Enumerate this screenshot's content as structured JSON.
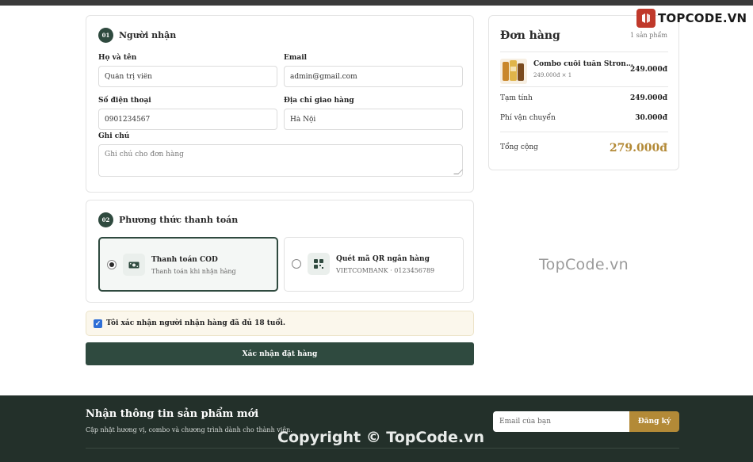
{
  "recipient": {
    "step": "01",
    "title": "Người nhận",
    "name_label": "Họ và tên",
    "name_value": "Quản trị viên",
    "email_label": "Email",
    "email_value": "admin@gmail.com",
    "phone_label": "Số điện thoại",
    "phone_value": "0901234567",
    "address_label": "Địa chỉ giao hàng",
    "address_value": "Hà Nội",
    "note_label": "Ghi chú",
    "note_placeholder": "Ghi chú cho đơn hàng"
  },
  "payment": {
    "step": "02",
    "title": "Phương thức thanh toán",
    "options": [
      {
        "name": "Thanh toán COD",
        "desc": "Thanh toán khi nhận hàng",
        "selected": true,
        "icon": "cash-icon"
      },
      {
        "name": "Quét mã QR ngân hàng",
        "desc": "VIETCOMBANK · 0123456789",
        "selected": false,
        "icon": "qr-code-icon"
      }
    ]
  },
  "agreement": {
    "text": "Tôi xác nhận người nhận hàng đã đủ 18 tuổi.",
    "checked": true
  },
  "submit_label": "Xác nhận đặt hàng",
  "order": {
    "title": "Đơn hàng",
    "count": "1 sản phẩm",
    "item": {
      "name": "Combo cuối tuần Strongbow…",
      "sub": "249.000đ × 1",
      "price": "249.000đ"
    },
    "subtotal_label": "Tạm tính",
    "subtotal_value": "249.000đ",
    "shipping_label": "Phí vận chuyển",
    "shipping_value": "30.000đ",
    "total_label": "Tổng cộng",
    "total_value": "279.000đ"
  },
  "footer": {
    "title": "Nhận thông tin sản phẩm mới",
    "subtitle": "Cập nhật hương vị, combo và chương trình dành cho thành viên.",
    "email_placeholder": "Email của bạn",
    "subscribe_label": "Đăng ký"
  },
  "watermarks": {
    "logo_text": "TOPCODE.VN",
    "center_text": "TopCode.vn",
    "copyright": "Copyright © TopCode.vn"
  },
  "colors": {
    "primary": "#2f4a3f",
    "gold": "#b38a37",
    "footer_bg": "#23302a",
    "notice_bg": "#fbf7ec"
  }
}
